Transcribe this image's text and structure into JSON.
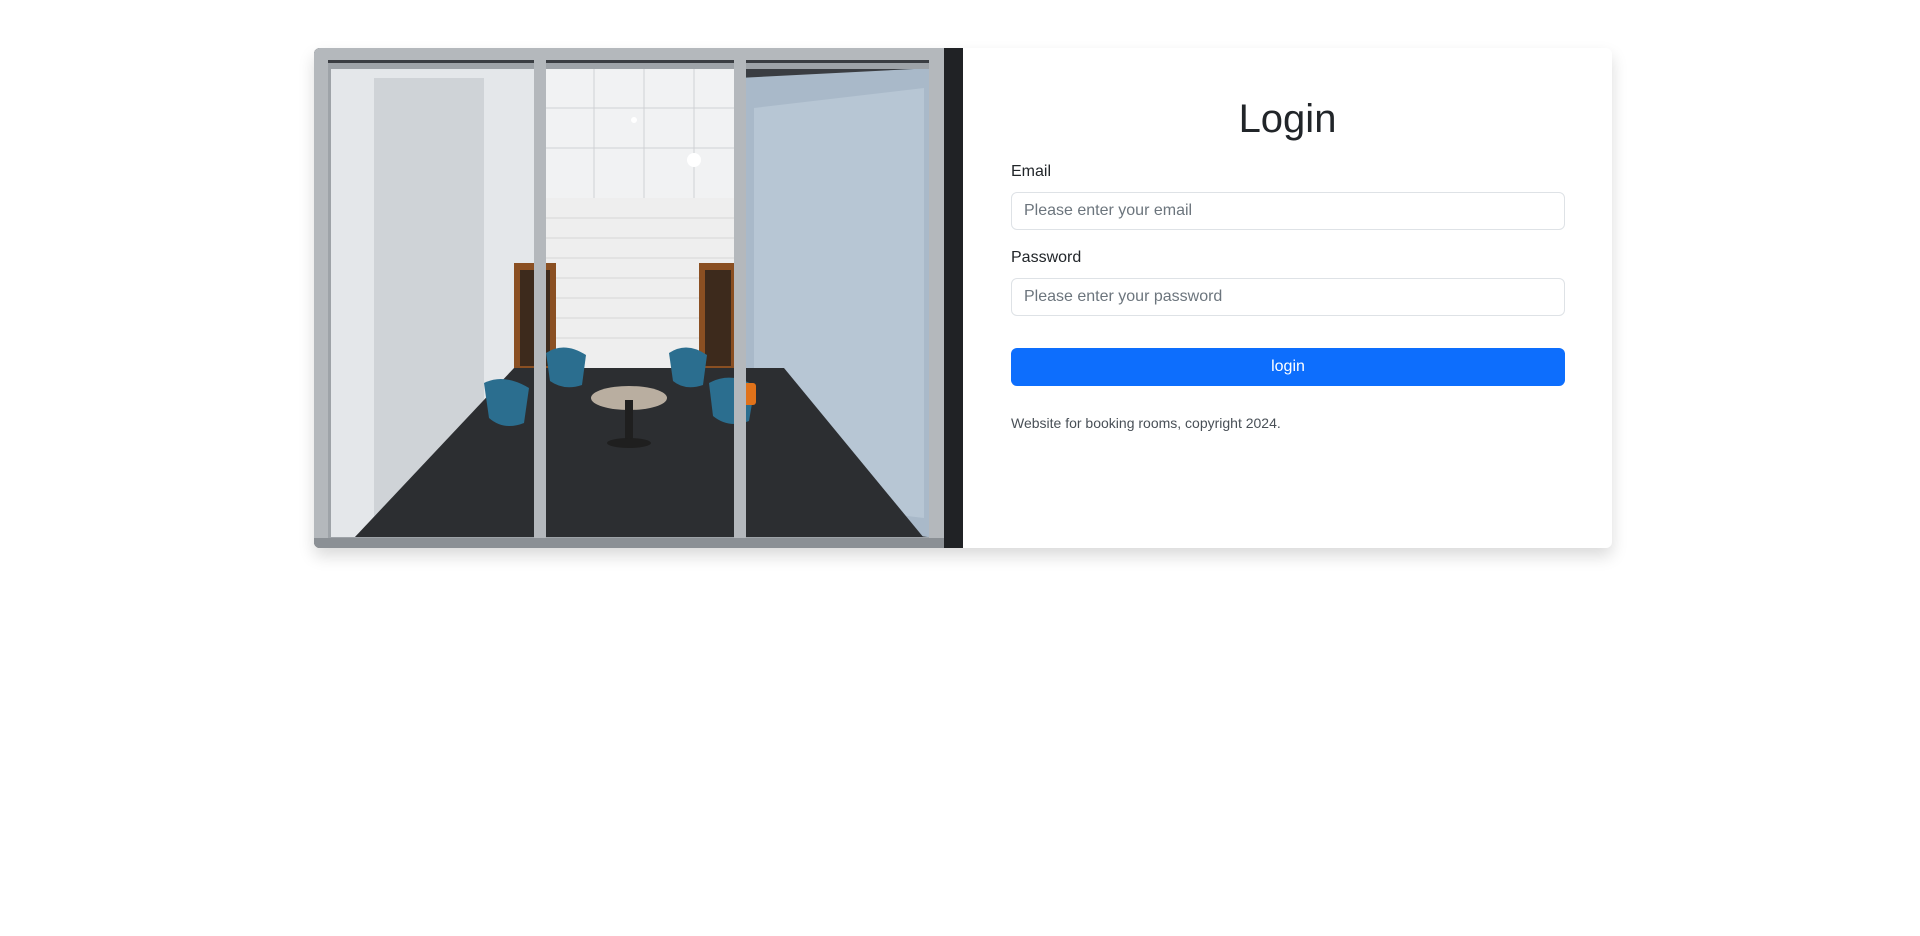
{
  "login": {
    "title": "Login",
    "email_label": "Email",
    "email_placeholder": "Please enter your email",
    "email_value": "",
    "password_label": "Password",
    "password_placeholder": "Please enter your password",
    "password_value": "",
    "submit_label": "login",
    "footer_text": "Website for booking rooms, copyright 2024."
  },
  "colors": {
    "primary": "#0d6efd",
    "input_border": "#dee2e6",
    "text": "#212529"
  },
  "image": {
    "subject": "meeting-room-photo"
  }
}
